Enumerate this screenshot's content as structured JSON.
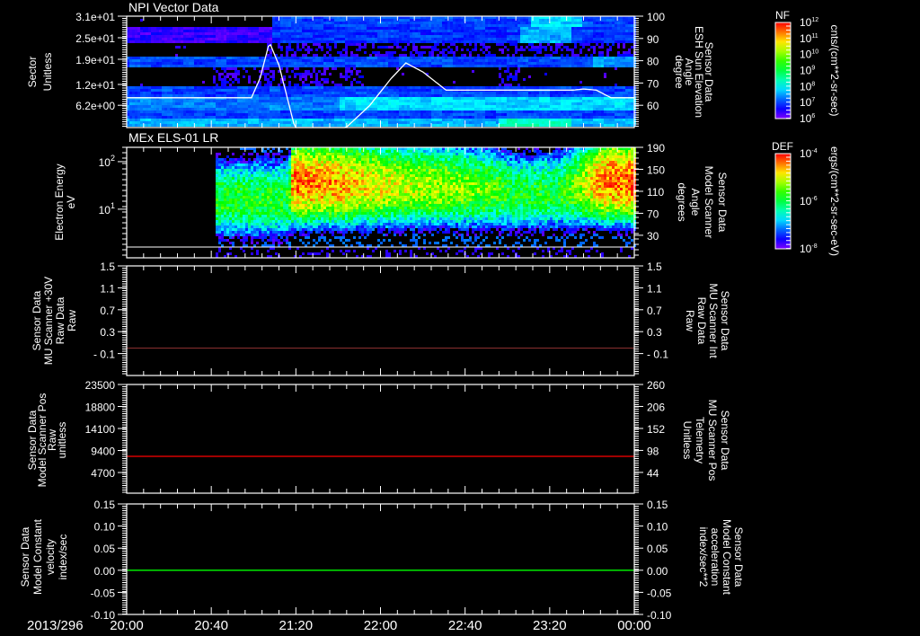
{
  "chart_data": [
    {
      "type": "heatmap",
      "title": "NPI Vector Data",
      "ylabel_lines": [
        "Sector",
        "Unitless"
      ],
      "ylim": [
        0,
        31
      ],
      "yticks": [
        31,
        25,
        19,
        12,
        6.2
      ],
      "ytick_labels": [
        "3.1e+01",
        "2.5e+01",
        "1.9e+01",
        "1.2e+01",
        "6.2e+00"
      ],
      "colorbar": {
        "label": "NF",
        "units": "cnts/(cm**2-sr-sec)",
        "log_range": [
          6,
          12
        ],
        "tick_exponents": [
          "12",
          "11",
          "10",
          "9",
          "8",
          "7",
          "6"
        ]
      },
      "bands": [
        {
          "sector": [
            28,
            31
          ],
          "segments": [
            [
              0,
              68,
              0
            ],
            [
              68,
              240,
              7.0
            ],
            [
              190,
              215,
              7.8
            ]
          ]
        },
        {
          "sector": [
            23.3,
            28
          ],
          "segments": [
            [
              0,
              68,
              6.4
            ],
            [
              68,
              240,
              6.9
            ],
            [
              186,
              210,
              7.6
            ]
          ]
        },
        {
          "sector": [
            20,
            23.3
          ],
          "segments": [
            [
              0,
              240,
              0
            ],
            [
              65,
              240,
              -6.4
            ]
          ]
        },
        {
          "sector": [
            16.8,
            20
          ],
          "segments": [
            [
              0,
              240,
              7.0
            ],
            [
              220,
              240,
              7.5
            ]
          ]
        },
        {
          "sector": [
            11.7,
            16.8
          ],
          "segments": [
            [
              0,
              240,
              0
            ],
            [
              40,
              112,
              -6.4
            ],
            [
              175,
              185,
              -6.4
            ]
          ]
        },
        {
          "sector": [
            8.5,
            11.7
          ],
          "segments": [
            [
              0,
              240,
              7.0
            ]
          ]
        },
        {
          "sector": [
            5,
            8.5
          ],
          "segments": [
            [
              0,
              100,
              7.3
            ],
            [
              100,
              240,
              7.8
            ]
          ]
        },
        {
          "sector": [
            2.5,
            5
          ],
          "segments": [
            [
              0,
              240,
              7.0
            ]
          ]
        },
        {
          "sector": [
            0,
            2.5
          ],
          "segments": [
            [
              0,
              240,
              7.6
            ],
            [
              175,
              210,
              8.3
            ]
          ]
        }
      ],
      "overlay": {
        "name": "ESH Sun Elevation Angle",
        "ylabel_lines": [
          "Sensor Data",
          "ESH Sun Elevation",
          "Angle",
          "degree"
        ],
        "ylim": [
          50,
          100
        ],
        "yticks": [
          100,
          90,
          80,
          70,
          60
        ],
        "color": "#ffffff",
        "points_min_deg": [
          [
            0,
            63.4
          ],
          [
            59,
            63.4
          ],
          [
            63,
            72
          ],
          [
            67.5,
            88.3
          ],
          [
            72,
            78
          ],
          [
            79.5,
            50
          ],
          [
            82,
            40
          ],
          [
            100,
            40
          ],
          [
            103.7,
            50
          ],
          [
            115,
            60
          ],
          [
            125,
            72
          ],
          [
            132,
            79
          ],
          [
            140,
            75
          ],
          [
            151,
            66.8
          ],
          [
            211,
            66.8
          ],
          [
            216,
            67.3
          ],
          [
            222,
            66.8
          ],
          [
            229,
            63.4
          ],
          [
            240,
            63.4
          ]
        ]
      }
    },
    {
      "type": "heatmap",
      "title": "MEx ELS-01 LR",
      "ylabel_lines": [
        "Electron Energy",
        "eV"
      ],
      "yscale": "log",
      "ylim": [
        0.95,
        200
      ],
      "yticks": [
        100,
        10
      ],
      "ytick_labels": [
        "10",
        "10"
      ],
      "ytick_sup": [
        "2",
        "1"
      ],
      "colorbar": {
        "label": "DEF",
        "units": "ergs/(cm**2-sr-sec-eV)",
        "log_range": [
          -8,
          -4
        ],
        "tick_exponents": [
          "-4",
          "-6",
          "-8"
        ]
      },
      "data_start_min": 42,
      "profile": [
        [
          42,
          15,
          -5.8
        ],
        [
          76,
          15,
          -5.8
        ],
        [
          78,
          35,
          -4.4
        ],
        [
          100,
          33,
          -4.6
        ],
        [
          130,
          30,
          -5.1
        ],
        [
          170,
          25,
          -5.5
        ],
        [
          185,
          20,
          -5.9
        ],
        [
          205,
          22,
          -5.8
        ],
        [
          215,
          30,
          -5.2
        ],
        [
          225,
          38,
          -4.4
        ],
        [
          240,
          38,
          -4.3
        ]
      ],
      "profile_columns": [
        "minute",
        "peak_energy_eV",
        "peak_log_def"
      ],
      "overlay": {
        "name": "Model Scanner Angle",
        "ylabel_lines": [
          "Sensor Data",
          "Model Scanner",
          "Angle",
          "degrees"
        ],
        "ylim": [
          -11,
          190
        ],
        "yticks": [
          190,
          150,
          110,
          70,
          30
        ],
        "energy_line_eV": 1.6,
        "color": "#ffffff"
      }
    },
    {
      "type": "line",
      "ylabel_lines": [
        "Sensor Data",
        "MU Scanner +30V",
        "Raw Data",
        "Raw"
      ],
      "ylim": [
        -0.5,
        1.5
      ],
      "yticks": [
        1.5,
        1.1,
        0.7,
        0.3,
        -0.1
      ],
      "ytick_labels": [
        "1.5",
        "1.1",
        "0.7",
        "0.3",
        "- 0.1"
      ],
      "right": {
        "ylabel_lines": [
          "Sensor Data",
          "MU Scanner Int",
          "Raw Data",
          "Raw"
        ],
        "ylim": [
          -0.5,
          1.5
        ],
        "yticks": [
          1.5,
          1.1,
          0.7,
          0.3,
          -0.1
        ],
        "ytick_labels": [
          "1.5",
          "1.1",
          "0.7",
          "0.3",
          "- 0.1"
        ],
        "color": "#ff0000"
      },
      "series": [
        {
          "name": "MU Scanner Int",
          "value": 0.0,
          "color": "#7a2a2a"
        }
      ]
    },
    {
      "type": "line",
      "ylabel_lines": [
        "Sensor Data",
        "Model Scanner Pos",
        "Raw",
        "unitless"
      ],
      "ylim": [
        290,
        23500
      ],
      "yticks": [
        23500,
        18800,
        14100,
        9400,
        4700
      ],
      "ytick_labels": [
        "23500",
        "18800",
        "14100",
        "9400",
        "4700"
      ],
      "right": {
        "ylabel_lines": [
          "Sensor Data",
          "MU Scanner Pos",
          "Telemetry",
          "Unitless"
        ],
        "ylim": [
          -7,
          260
        ],
        "yticks": [
          260,
          206,
          152,
          98,
          44
        ],
        "ytick_labels": [
          "260",
          "206",
          "152",
          "98",
          "44"
        ],
        "color": "#ff0000"
      },
      "series": [
        {
          "name": "MU Scanner Pos",
          "value": 8150,
          "color": "#ff0000"
        }
      ]
    },
    {
      "type": "line",
      "ylabel_lines": [
        "Sensor Data",
        "Model Constant",
        "velocity",
        "index/sec"
      ],
      "ylim": [
        -0.1,
        0.15
      ],
      "yticks": [
        0.15,
        0.1,
        0.05,
        0.0,
        -0.05,
        -0.1
      ],
      "ytick_labels": [
        "0.15",
        "0.10",
        "0.05",
        "0.00",
        "-0.05",
        "-0.10"
      ],
      "right": {
        "ylabel_lines": [
          "Sensor Data",
          "Model Constant",
          "acceleration",
          "index/sec**2"
        ],
        "ylim": [
          -0.1,
          0.15
        ],
        "yticks": [
          0.15,
          0.1,
          0.05,
          0.0,
          -0.05,
          -0.1
        ],
        "ytick_labels": [
          "0.15",
          "0.10",
          "0.05",
          "0.00",
          "-0.05",
          "-0.10"
        ],
        "color": "#00ff00"
      },
      "series": [
        {
          "name": "Model Constant acceleration",
          "value": 0.0,
          "color": "#00ff00"
        }
      ]
    }
  ],
  "xaxis": {
    "date": "2013/296",
    "xlim_min": [
      0,
      240
    ],
    "tick_minutes": [
      0,
      40,
      80,
      120,
      160,
      200,
      240
    ],
    "tick_labels": [
      "20:00",
      "20:40",
      "21:20",
      "22:00",
      "22:40",
      "23:20",
      "00:00"
    ],
    "minor_every_min": 8
  }
}
